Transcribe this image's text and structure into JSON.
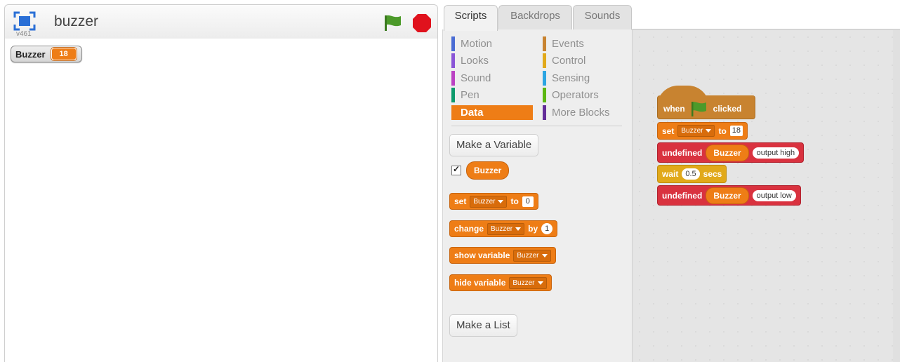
{
  "stage": {
    "title": "buzzer",
    "version": "v461",
    "monitor": {
      "label": "Buzzer",
      "value": "18"
    }
  },
  "tabs": [
    {
      "label": "Scripts"
    },
    {
      "label": "Backdrops"
    },
    {
      "label": "Sounds"
    }
  ],
  "categories": {
    "motion": {
      "label": "Motion",
      "color": "#4a6cd4"
    },
    "looks": {
      "label": "Looks",
      "color": "#8a55d7"
    },
    "sound": {
      "label": "Sound",
      "color": "#bb42c3"
    },
    "pen": {
      "label": "Pen",
      "color": "#0e9a6c"
    },
    "data": {
      "label": "Data",
      "color": "#ee7d16"
    },
    "events": {
      "label": "Events",
      "color": "#c88330"
    },
    "control": {
      "label": "Control",
      "color": "#e1a91a"
    },
    "sensing": {
      "label": "Sensing",
      "color": "#2ca5e2"
    },
    "operators": {
      "label": "Operators",
      "color": "#5cb712"
    },
    "more_blocks": {
      "label": "More Blocks",
      "color": "#632d99"
    }
  },
  "palette": {
    "make_variable": "Make a Variable",
    "make_list": "Make a List",
    "variable_name": "Buzzer",
    "variable_checked": true,
    "set_block": {
      "label": "set",
      "var": "Buzzer",
      "to": "to",
      "value": "0"
    },
    "change_block": {
      "label": "change",
      "var": "Buzzer",
      "by": "by",
      "value": "1"
    },
    "show_block": {
      "label": "show variable",
      "var": "Buzzer"
    },
    "hide_block": {
      "label": "hide variable",
      "var": "Buzzer"
    }
  },
  "script": {
    "hat": {
      "when": "when",
      "clicked": "clicked"
    },
    "set": {
      "label": "set",
      "var": "Buzzer",
      "to": "to",
      "value": "18"
    },
    "cmd1": {
      "label": "undefined",
      "arg": "Buzzer",
      "value": "output high"
    },
    "wait": {
      "label": "wait",
      "value": "0.5",
      "unit": "secs"
    },
    "cmd2": {
      "label": "undefined",
      "arg": "Buzzer",
      "value": "output low"
    }
  },
  "colors": {
    "data": "#ee7d16",
    "events": "#c88330",
    "control": "#e1a91a",
    "custom_red": "#d9323f",
    "flag_green": "#4c9a2a",
    "stop_red": "#e0121d"
  }
}
